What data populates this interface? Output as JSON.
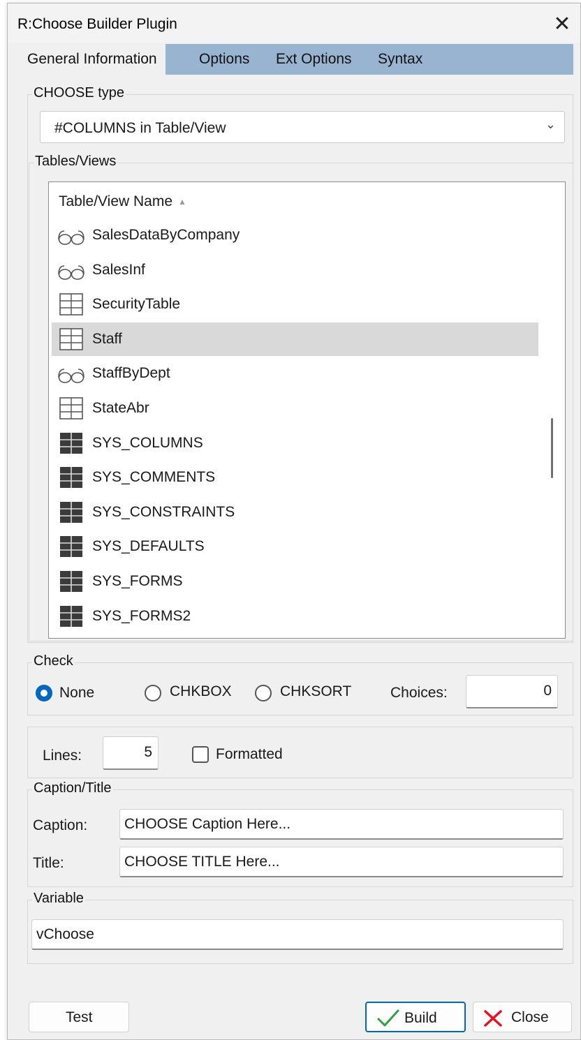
{
  "window": {
    "title": "R:Choose Builder Plugin",
    "close_glyph": "✕"
  },
  "tabs": [
    {
      "label": "General Information",
      "active": true
    },
    {
      "label": "Options",
      "active": false
    },
    {
      "label": "Ext Options",
      "active": false
    },
    {
      "label": "Syntax",
      "active": false
    }
  ],
  "choose_type": {
    "label": "CHOOSE type",
    "value": "#COLUMNS in Table/View"
  },
  "tables": {
    "label": "Tables/Views",
    "header": "Table/View Name",
    "selected_index": 3,
    "rows": [
      {
        "name": "SalesDataByCompany",
        "icon": "view-icon"
      },
      {
        "name": "SalesInf",
        "icon": "view-icon"
      },
      {
        "name": "SecurityTable",
        "icon": "table-icon"
      },
      {
        "name": "Staff",
        "icon": "table-icon"
      },
      {
        "name": "StaffByDept",
        "icon": "view-icon"
      },
      {
        "name": "StateAbr",
        "icon": "table-icon"
      },
      {
        "name": "SYS_COLUMNS",
        "icon": "system-table-icon"
      },
      {
        "name": "SYS_COMMENTS",
        "icon": "system-table-icon"
      },
      {
        "name": "SYS_CONSTRAINTS",
        "icon": "system-table-icon"
      },
      {
        "name": "SYS_DEFAULTS",
        "icon": "system-table-icon"
      },
      {
        "name": "SYS_FORMS",
        "icon": "system-table-icon"
      },
      {
        "name": "SYS_FORMS2",
        "icon": "system-table-icon"
      }
    ]
  },
  "check": {
    "label": "Check",
    "options": [
      {
        "label": "None",
        "selected": true
      },
      {
        "label": "CHKBOX",
        "selected": false
      },
      {
        "label": "CHKSORT",
        "selected": false
      }
    ],
    "choices_label": "Choices:",
    "choices_value": "0"
  },
  "lines": {
    "label": "Lines:",
    "value": "5",
    "formatted_label": "Formatted",
    "formatted_checked": false
  },
  "caption_title": {
    "label": "Caption/Title",
    "caption_label": "Caption:",
    "caption_value": "CHOOSE Caption Here...",
    "title_label": "Title:",
    "title_value": "CHOOSE TITLE Here..."
  },
  "variable": {
    "label": "Variable",
    "value": "vChoose"
  },
  "buttons": {
    "test": "Test",
    "build": "Build",
    "close": "Close"
  },
  "colors": {
    "accent": "#0067c0",
    "tab_strip": "#99b4d1",
    "build_check": "#2ea043",
    "close_x": "#e81123"
  }
}
